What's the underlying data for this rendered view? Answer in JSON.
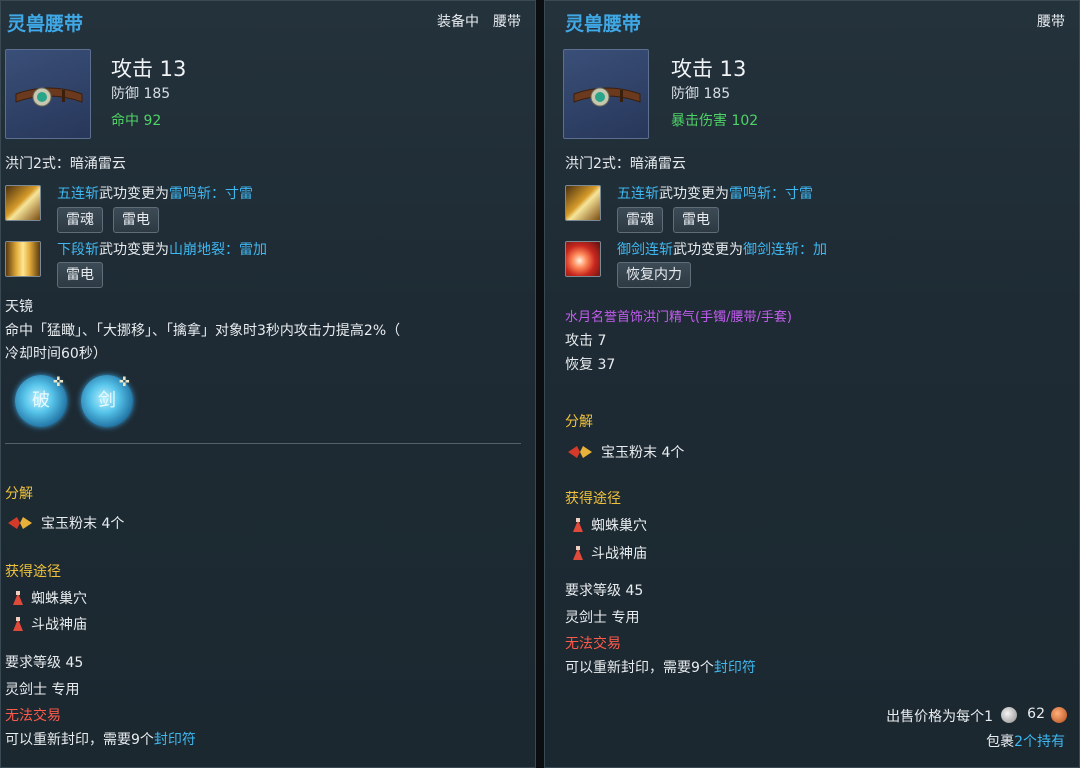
{
  "left": {
    "title": "灵兽腰带",
    "equipped": "装备中",
    "slot": "腰带",
    "attack": "攻击 13",
    "defense": "防御 185",
    "bonus": "命中 92",
    "set_line": "洪门2式：暗涌雷云",
    "skill1": {
      "name": "五连斩",
      "mid": "武功变更为",
      "target": "雷鸣斩：寸雷",
      "tags": [
        "雷魂",
        "雷电"
      ]
    },
    "skill2": {
      "name": "下段斩",
      "mid": "武功变更为",
      "target": "山崩地裂：雷加",
      "tags": [
        "雷电"
      ]
    },
    "tianjing_title": "天镜",
    "tianjing_desc1": "命中「猛瞰」、「大挪移」、「擒拿」对象时3秒内攻击力提高2%（",
    "tianjing_desc2": "冷却时间60秒）",
    "orbs": [
      "破",
      "剑"
    ],
    "decompose_title": "分解",
    "decompose_item": "宝玉粉末 4个",
    "obtain_title": "获得途径",
    "obtain_items": [
      "蜘蛛巢穴",
      "斗战神庙"
    ],
    "req_level": "要求等级 45",
    "req_class": "灵剑士 专用",
    "no_trade": "无法交易",
    "reseal_prefix": "可以重新封印，需要9个",
    "reseal_link": "封印符"
  },
  "right": {
    "title": "灵兽腰带",
    "slot": "腰带",
    "attack": "攻击 13",
    "defense": "防御 185",
    "bonus": "暴击伤害 102",
    "set_line": "洪门2式：暗涌雷云",
    "skill1": {
      "name": "五连斩",
      "mid": "武功变更为",
      "target": "雷鸣斩：寸雷",
      "tags": [
        "雷魂",
        "雷电"
      ]
    },
    "skill2": {
      "name": "御剑连斩",
      "mid": "武功变更为",
      "target": "御剑连斩：加",
      "tags": [
        "恢复内力"
      ]
    },
    "set_name": "水月名誉首饰洪门精气(手镯/腰带/手套)",
    "extra1": "攻击 7",
    "extra2": "恢复 37",
    "decompose_title": "分解",
    "decompose_item": "宝玉粉末 4个",
    "obtain_title": "获得途径",
    "obtain_items": [
      "蜘蛛巢穴",
      "斗战神庙"
    ],
    "req_level": "要求等级 45",
    "req_class": "灵剑士 专用",
    "no_trade": "无法交易",
    "reseal_prefix": "可以重新封印，需要9个",
    "reseal_link": "封印符",
    "sell_label": "出售价格为每个1",
    "sell_value": "62",
    "bag_prefix": "包裹",
    "bag_count": "2个持有"
  }
}
